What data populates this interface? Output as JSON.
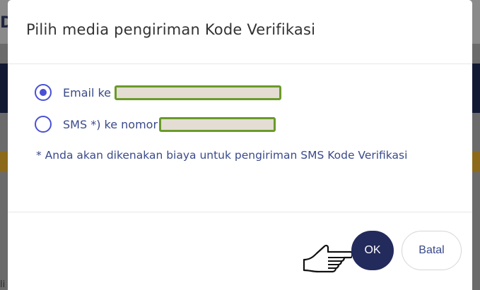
{
  "background": {
    "header_letter": "D",
    "bottom_letter": "li"
  },
  "dialog": {
    "title": "Pilih media pengiriman Kode Verifikasi",
    "options": [
      {
        "label": "Email ke",
        "selected": true,
        "value_redacted": true
      },
      {
        "label": "SMS *) ke nomor",
        "selected": false,
        "value_redacted": true
      }
    ],
    "note": "* Anda akan dikenakan biaya untuk pengiriman SMS Kode Verifikasi",
    "buttons": {
      "ok": "OK",
      "cancel": "Batal"
    }
  },
  "icons": {
    "pointer": "pointing-hand-icon"
  },
  "colors": {
    "primary": "#232a5c",
    "radio": "#4a4fd6",
    "text": "#3a4a8a",
    "redaction_border": "#6a9a2a",
    "redaction_fill": "#e3ddd3"
  }
}
